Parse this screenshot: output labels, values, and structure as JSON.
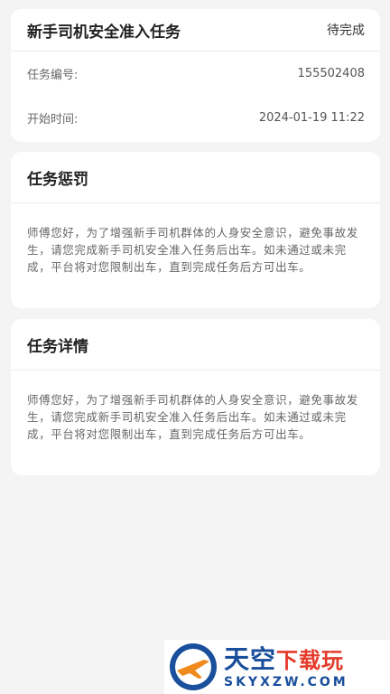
{
  "task": {
    "title": "新手司机安全准入任务",
    "status": "待完成",
    "number_label": "任务编号:",
    "number_value": "155502408",
    "start_label": "开始时间:",
    "start_value": "2024-01-19 11:22"
  },
  "penalty": {
    "title": "任务惩罚",
    "text": "师傅您好，为了增强新手司机群体的人身安全意识，避免事故发生，请您完成新手司机安全准入任务后出车。如未通过或未完成，平台将对您限制出车，直到完成任务后方可出车。"
  },
  "detail": {
    "title": "任务详情",
    "text": "师傅您好，为了增强新手司机群体的人身安全意识，避免事故发生，请您完成新手司机安全准入任务后出车。如未通过或未完成，平台将对您限制出车，直到完成任务后方可出车。"
  },
  "watermark": {
    "main_a": "天空",
    "main_b": "下载玩",
    "sub": "SKYXZW.COM"
  }
}
